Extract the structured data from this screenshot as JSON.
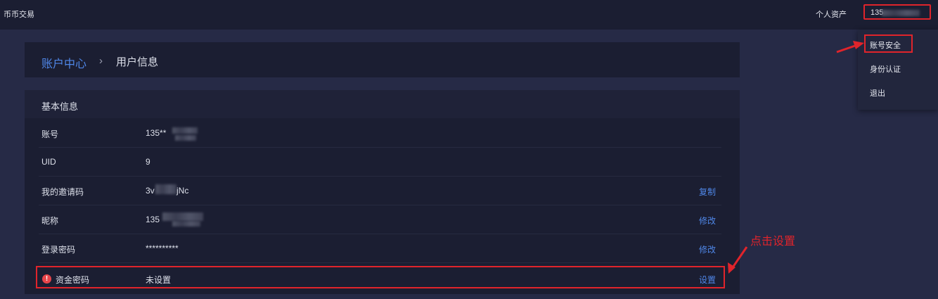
{
  "header": {
    "brand": "币币交易",
    "assets_label": "个人资产",
    "user_visible": "135"
  },
  "dropdown": {
    "items": [
      "账号安全",
      "身份认证",
      "退出"
    ]
  },
  "breadcrumb": {
    "parent": "账户中心",
    "separator": "›",
    "current": "用户信息"
  },
  "basic_info": {
    "title": "基本信息",
    "rows": [
      {
        "label": "账号",
        "value": "135**",
        "action": ""
      },
      {
        "label": "UID",
        "value": "9",
        "action": ""
      },
      {
        "label": "我的邀请码",
        "value": "3v",
        "value_tail": "jNc",
        "action": "复制"
      },
      {
        "label": "昵称",
        "value": "135",
        "action": "修改"
      },
      {
        "label": "登录密码",
        "value": "**********",
        "action": "修改"
      },
      {
        "label": "资金密码",
        "value": "未设置",
        "action": "设置"
      }
    ]
  },
  "annotation": {
    "callout": "点击设置"
  },
  "colors": {
    "accent": "#4f87e8",
    "highlight": "#e0242b",
    "warning": "#e8454a"
  }
}
